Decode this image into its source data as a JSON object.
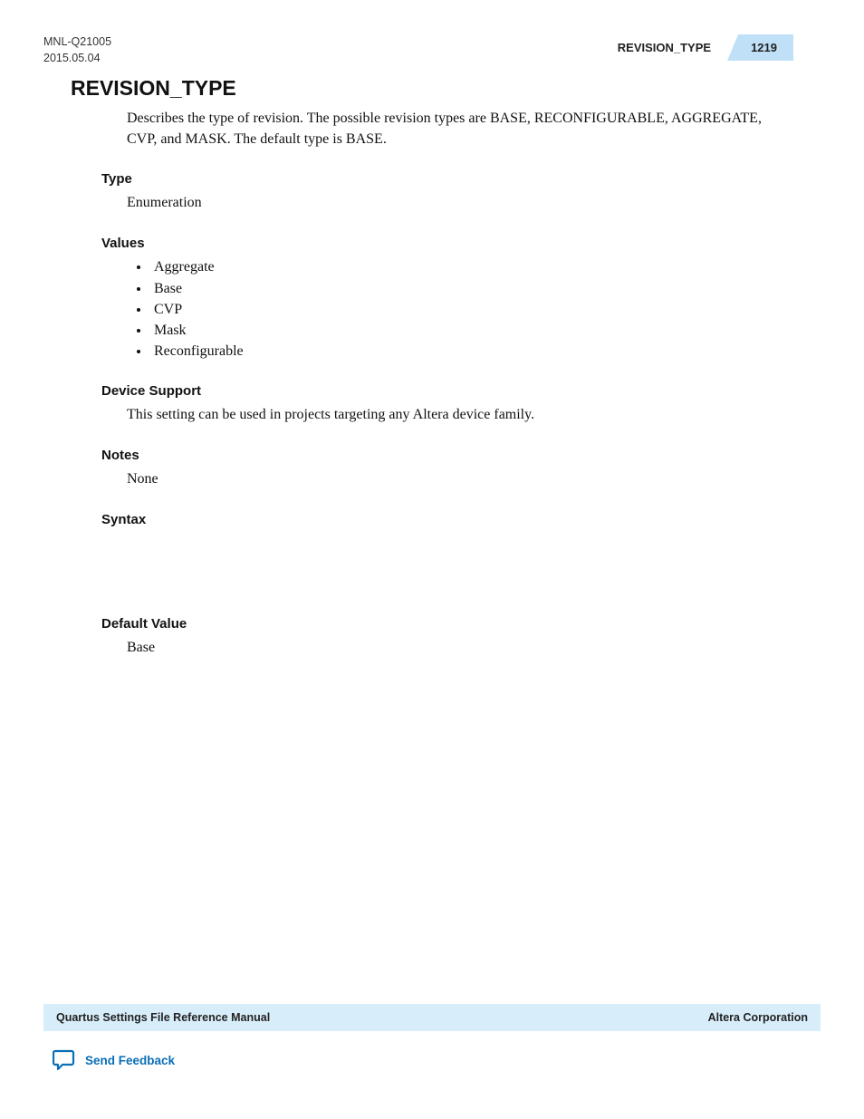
{
  "header": {
    "doc_id": "MNL-Q21005",
    "date": "2015.05.04",
    "running_title": "REVISION_TYPE",
    "page_number": "1219"
  },
  "title": "REVISION_TYPE",
  "intro": "Describes the type of revision. The possible revision types are BASE, RECONFIGURABLE, AGGREGATE, CVP, and MASK. The default type is BASE.",
  "sections": {
    "type": {
      "heading": "Type",
      "body": "Enumeration"
    },
    "values": {
      "heading": "Values",
      "items": [
        "Aggregate",
        "Base",
        "CVP",
        "Mask",
        "Reconfigurable"
      ]
    },
    "device_support": {
      "heading": "Device Support",
      "body": "This setting can be used in projects targeting any Altera device family."
    },
    "notes": {
      "heading": "Notes",
      "body": "None"
    },
    "syntax": {
      "heading": "Syntax"
    },
    "default_value": {
      "heading": "Default Value",
      "body": "Base"
    }
  },
  "footer": {
    "left": "Quartus Settings File Reference Manual",
    "right": "Altera Corporation"
  },
  "feedback": {
    "label": "Send Feedback"
  }
}
